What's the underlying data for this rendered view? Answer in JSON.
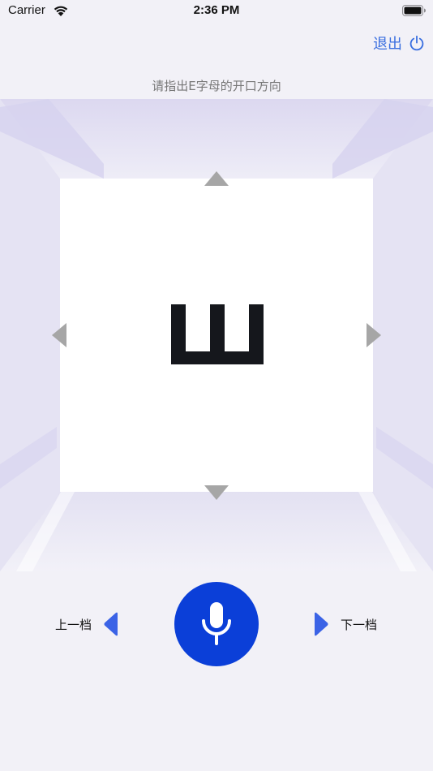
{
  "status_bar": {
    "carrier": "Carrier",
    "time": "2:36 PM",
    "icons": [
      "wifi-icon",
      "battery-icon"
    ]
  },
  "header": {
    "exit_label": "退出",
    "exit_icon": "power-icon"
  },
  "instruction": "请指出E字母的开口方向",
  "test": {
    "optotype": "E",
    "orientation": "up",
    "arrows": [
      "up",
      "down",
      "left",
      "right"
    ]
  },
  "controls": {
    "prev_label": "上一档",
    "next_label": "下一档",
    "mic_icon": "microphone-icon"
  },
  "colors": {
    "accent": "#0b3fd8",
    "link": "#3a6fe0",
    "arrow_gray": "#a6a6a6",
    "background": "#f2f1f7"
  }
}
